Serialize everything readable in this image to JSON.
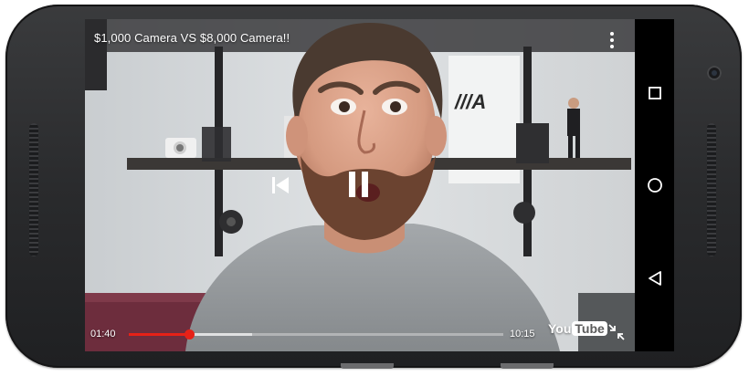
{
  "video": {
    "title": "$1,000 Camera VS $8,000 Camera!!",
    "current_time": "01:40",
    "duration": "10:15",
    "progress_played_fraction": 0.16,
    "progress_buffered_fraction": 0.33,
    "logo": {
      "you": "You",
      "tube": "Tube"
    },
    "accent_color": "#e62117"
  },
  "icons": {
    "menu": "more-vert-icon",
    "previous": "skip-previous-icon",
    "pause": "pause-icon",
    "exit_fullscreen": "exit-fullscreen-icon"
  },
  "navbar": {
    "recents": "recents-square-icon",
    "home": "home-circle-icon",
    "back": "back-triangle-icon"
  }
}
